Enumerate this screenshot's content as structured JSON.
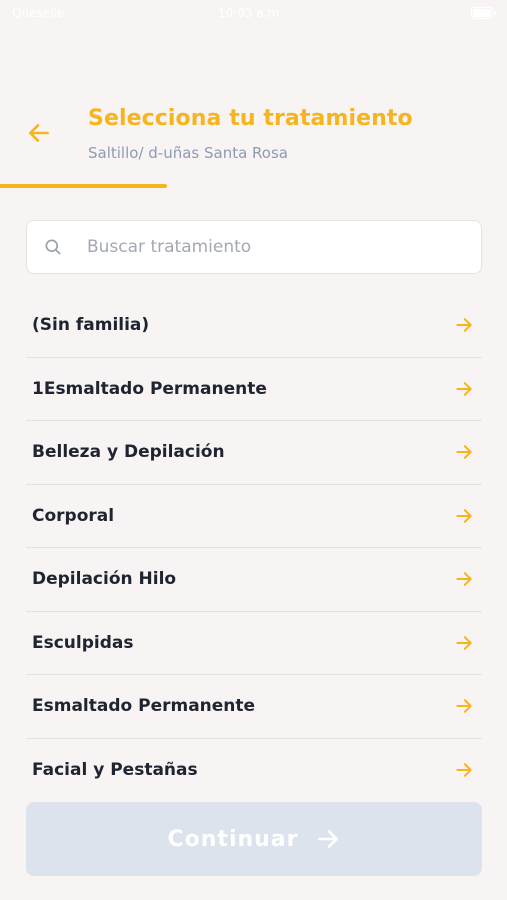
{
  "status_bar": {
    "carrier": "Queselle",
    "time": "10:03 a.m."
  },
  "header": {
    "title": "Selecciona tu tratamiento",
    "subtitle": "Saltillo/ d-uñas Santa Rosa"
  },
  "progress": {
    "value": 0.33
  },
  "search": {
    "placeholder": "Buscar tratamiento",
    "value": ""
  },
  "list": {
    "items": [
      {
        "label": "(Sin familia)"
      },
      {
        "label": "1Esmaltado Permanente"
      },
      {
        "label": "Belleza y Depilación"
      },
      {
        "label": "Corporal"
      },
      {
        "label": "Depilación Hilo"
      },
      {
        "label": "Esculpidas"
      },
      {
        "label": "Esmaltado Permanente"
      },
      {
        "label": "Facial y Pestañas"
      }
    ]
  },
  "footer": {
    "continue_label": "Continuar",
    "continue_enabled": false
  },
  "icons": {
    "back": "arrow-left-icon",
    "search": "search-icon",
    "item_arrow": "arrow-right-icon",
    "continue_arrow": "arrow-right-icon"
  },
  "colors": {
    "accent": "#f6b51e",
    "subtitle": "#8e9bb4",
    "background": "#f7f4f3",
    "item_text": "#1f2430",
    "button_disabled": "#dce3ed",
    "divider": "#e3e0de"
  }
}
